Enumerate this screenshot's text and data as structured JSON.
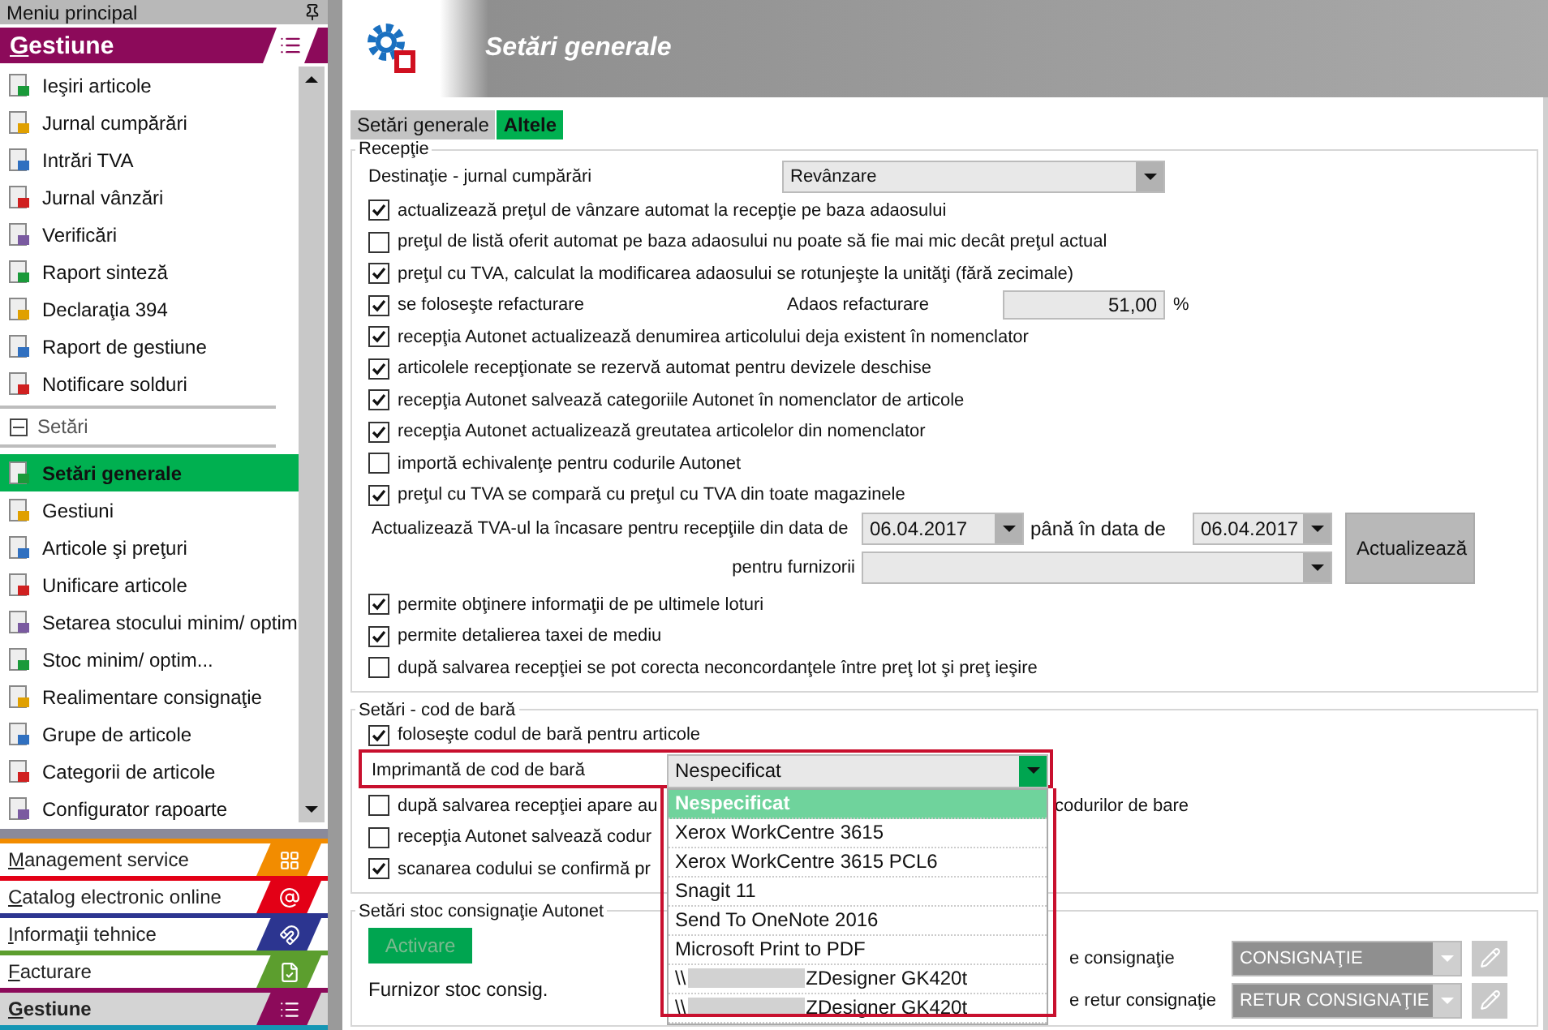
{
  "sidebar": {
    "title": "Meniu principal",
    "section": {
      "label": "Gestiune"
    },
    "items": [
      {
        "kind": "item",
        "label": "Ieşiri articole",
        "selected": false
      },
      {
        "kind": "item",
        "label": "Jurnal cumpărări",
        "selected": false
      },
      {
        "kind": "item",
        "label": "Intrări TVA",
        "selected": false
      },
      {
        "kind": "item",
        "label": "Jurnal vânzări",
        "selected": false
      },
      {
        "kind": "item",
        "label": "Verificări",
        "selected": false
      },
      {
        "kind": "item",
        "label": "Raport sinteză",
        "selected": false
      },
      {
        "kind": "item",
        "label": "Declaraţia 394",
        "selected": false
      },
      {
        "kind": "item",
        "label": "Raport de gestiune",
        "selected": false
      },
      {
        "kind": "item",
        "label": "Notificare solduri",
        "selected": false
      },
      {
        "kind": "group",
        "label": "Setări",
        "expanded": true,
        "children": [
          {
            "kind": "item",
            "label": "Setări generale",
            "selected": true
          },
          {
            "kind": "item",
            "label": "Gestiuni",
            "selected": false
          },
          {
            "kind": "item",
            "label": "Articole şi preţuri",
            "selected": false
          },
          {
            "kind": "item",
            "label": "Unificare articole",
            "selected": false
          },
          {
            "kind": "item",
            "label": "Setarea stocului minim/ optim",
            "selected": false
          },
          {
            "kind": "item",
            "label": "Stoc minim/ optim...",
            "selected": false
          },
          {
            "kind": "item",
            "label": "Realimentare consignaţie",
            "selected": false
          },
          {
            "kind": "item",
            "label": "Grupe de articole",
            "selected": false
          },
          {
            "kind": "item",
            "label": "Categorii de articole",
            "selected": false
          },
          {
            "kind": "item",
            "label": "Configurator rapoarte",
            "selected": false
          }
        ]
      }
    ],
    "nav": [
      {
        "label": "Management service",
        "color": "#f28c00",
        "selected": false
      },
      {
        "label": "Catalog electronic online",
        "color": "#e30016",
        "selected": false
      },
      {
        "label": "Informaţii tehnice",
        "color": "#2c3590",
        "selected": false
      },
      {
        "label": "Facturare",
        "color": "#5c9e2e",
        "selected": false
      },
      {
        "label": "Gestiune",
        "color": "#8c0a5a",
        "selected": true
      }
    ]
  },
  "header": {
    "title": "Setări generale"
  },
  "tabs": [
    {
      "label": "Setări generale",
      "selected": false
    },
    {
      "label": "Altele",
      "selected": true
    }
  ],
  "reception": {
    "legend": "Recepţie",
    "destination": {
      "label": "Destinaţie - jurnal cumpărări",
      "value": "Revânzare"
    },
    "options": [
      {
        "kind": "checkbox",
        "label": "actualizează preţul de vânzare automat la recepţie pe baza adaosului",
        "checked": true
      },
      {
        "kind": "checkbox",
        "label": "preţul de listă oferit automat pe baza adaosului nu poate să fie mai mic decât preţul actual",
        "checked": false
      },
      {
        "kind": "checkbox",
        "label": "preţul cu TVA, calculat la modificarea adaosului se rotunjeşte la unităţi (fără zecimale)",
        "checked": true
      },
      {
        "kind": "checkbox_field",
        "label": "se foloseşte refacturare",
        "checked": true,
        "field_label": "Adaos refacturare",
        "field_value": "51,00",
        "unit": "%"
      },
      {
        "kind": "checkbox",
        "label": "recepţia Autonet actualizează denumirea articolului deja existent în nomenclator",
        "checked": true
      },
      {
        "kind": "checkbox",
        "label": "articolele recepţionate se rezervă automat pentru devizele deschise",
        "checked": true
      },
      {
        "kind": "checkbox",
        "label": "recepţia Autonet salvează categoriile Autonet în nomenclator de articole",
        "checked": true
      },
      {
        "kind": "checkbox",
        "label": "recepţia Autonet actualizează greutatea articolelor din nomenclator",
        "checked": true
      },
      {
        "kind": "checkbox",
        "label": "importă echivalenţe pentru codurile Autonet",
        "checked": false
      },
      {
        "kind": "checkbox",
        "label": "preţul cu TVA se compară cu preţul cu TVA din toate magazinele",
        "checked": true
      }
    ],
    "tva_update": {
      "label": "Actualizează TVA-ul la încasare pentru recepţiile din data de",
      "from_date": "06.04.2017",
      "to_label": "până în data de",
      "to_date": "06.04.2017",
      "supplier_label": "pentru furnizorii",
      "button": "Actualizează"
    },
    "more_options": [
      {
        "label": "permite obţinere informaţii de pe ultimele loturi",
        "checked": true
      },
      {
        "label": "permite detalierea taxei de mediu",
        "checked": true
      },
      {
        "label": "după salvarea recepţiei se pot corecta neconcordanţele între preţ lot şi preţ ieşire",
        "checked": false
      }
    ]
  },
  "barcode": {
    "legend": "Setări - cod de bară",
    "use_barcode": {
      "label": "foloseşte codul de bară pentru articole",
      "checked": true
    },
    "printer": {
      "label": "Imprimantă de cod de bară",
      "value": "Nespecificat",
      "open": true,
      "options": [
        {
          "label": "Nespecificat",
          "selected": true,
          "redacted": false
        },
        {
          "label": "Xerox WorkCentre 3615",
          "selected": false,
          "redacted": false
        },
        {
          "label": "Xerox WorkCentre 3615 PCL6",
          "selected": false,
          "redacted": false
        },
        {
          "label": "Snagit 11",
          "selected": false,
          "redacted": false
        },
        {
          "label": "Send To OneNote 2016",
          "selected": false,
          "redacted": false
        },
        {
          "label": "Microsoft Print to PDF",
          "selected": false,
          "redacted": false
        },
        {
          "prefix": "\\\\",
          "label": "ZDesigner GK420t",
          "selected": false,
          "redacted": true
        },
        {
          "prefix": "\\\\",
          "label": "ZDesigner GK420t",
          "selected": false,
          "redacted": true
        }
      ]
    },
    "more_options": [
      {
        "label": "după salvarea recepţiei apare au",
        "tail": "codurilor de bare",
        "checked": false
      },
      {
        "label": "recepţia Autonet salvează codur",
        "checked": false
      },
      {
        "label": "scanarea codului se confirmă pr",
        "checked": true
      }
    ]
  },
  "consignment": {
    "legend": "Setări stoc consignaţie Autonet",
    "button": {
      "label": "Activare",
      "disabled": true
    },
    "supplier_label": "Furnizor stoc consig.",
    "rows": [
      {
        "label": "e consignaţie",
        "value": "CONSIGNAŢIE",
        "disabled": true
      },
      {
        "label": "e retur consignaţie",
        "value": "RETUR CONSIGNAŢIE",
        "disabled": true
      }
    ]
  }
}
